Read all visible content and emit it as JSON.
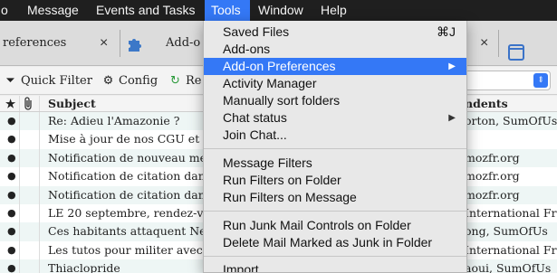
{
  "menubar": {
    "items": [
      "o",
      "Message",
      "Events and Tasks",
      "Tools",
      "Window",
      "Help"
    ],
    "active": "Tools"
  },
  "tabs": [
    {
      "label": "references",
      "close": "×"
    },
    {
      "label": "Add-o",
      "close": "×"
    },
    {
      "label": "",
      "close": "×"
    }
  ],
  "toolbar": {
    "quick_filter": "Quick Filter",
    "config": "Config",
    "third": "Re"
  },
  "list": {
    "headers": {
      "star": "★",
      "attach": "📎",
      "subject": "Subject",
      "correspondents": "ndents"
    },
    "rows": [
      {
        "subject": "Re: Adieu l'Amazonie ?",
        "correspondents": "orton, SumOfUs"
      },
      {
        "subject": "Mise à jour de nos CGU et de",
        "correspondents": ""
      },
      {
        "subject": "Notification de nouveau mess",
        "correspondents": "mozfr.org"
      },
      {
        "subject": "Notification de citation dans",
        "correspondents": "mozfr.org"
      },
      {
        "subject": "Notification de citation dans",
        "correspondents": "mozfr.org"
      },
      {
        "subject": "LE 20 septembre, rendez-vous",
        "correspondents": "International Fra"
      },
      {
        "subject": "Ces habitants attaquent Nestl",
        "correspondents": "ong, SumOfUs"
      },
      {
        "subject": "Les tutos pour militer avec A",
        "correspondents": "International Fra"
      },
      {
        "subject": "Thiaclopride",
        "correspondents": "aoui, SumOfUs"
      }
    ]
  },
  "tools_menu": {
    "items": [
      {
        "label": "Saved Files",
        "shortcut": "⌘J"
      },
      {
        "label": "Add-ons"
      },
      {
        "label": "Add-on Preferences",
        "submenu": "▶",
        "highlighted": true
      },
      {
        "label": "Activity Manager"
      },
      {
        "label": "Manually sort folders"
      },
      {
        "label": "Chat status",
        "submenu": "▶"
      },
      {
        "label": "Join Chat..."
      },
      {
        "label": "Message Filters"
      },
      {
        "label": "Run Filters on Folder"
      },
      {
        "label": "Run Filters on Message"
      },
      {
        "label": "Run Junk Mail Controls on Folder"
      },
      {
        "label": "Delete Mail Marked as Junk in Folder"
      },
      {
        "label": "Import..."
      }
    ]
  },
  "colors": {
    "highlight": "#3478f6",
    "menubar": "#1f1f1f",
    "row_alt": "#eef6f5"
  }
}
